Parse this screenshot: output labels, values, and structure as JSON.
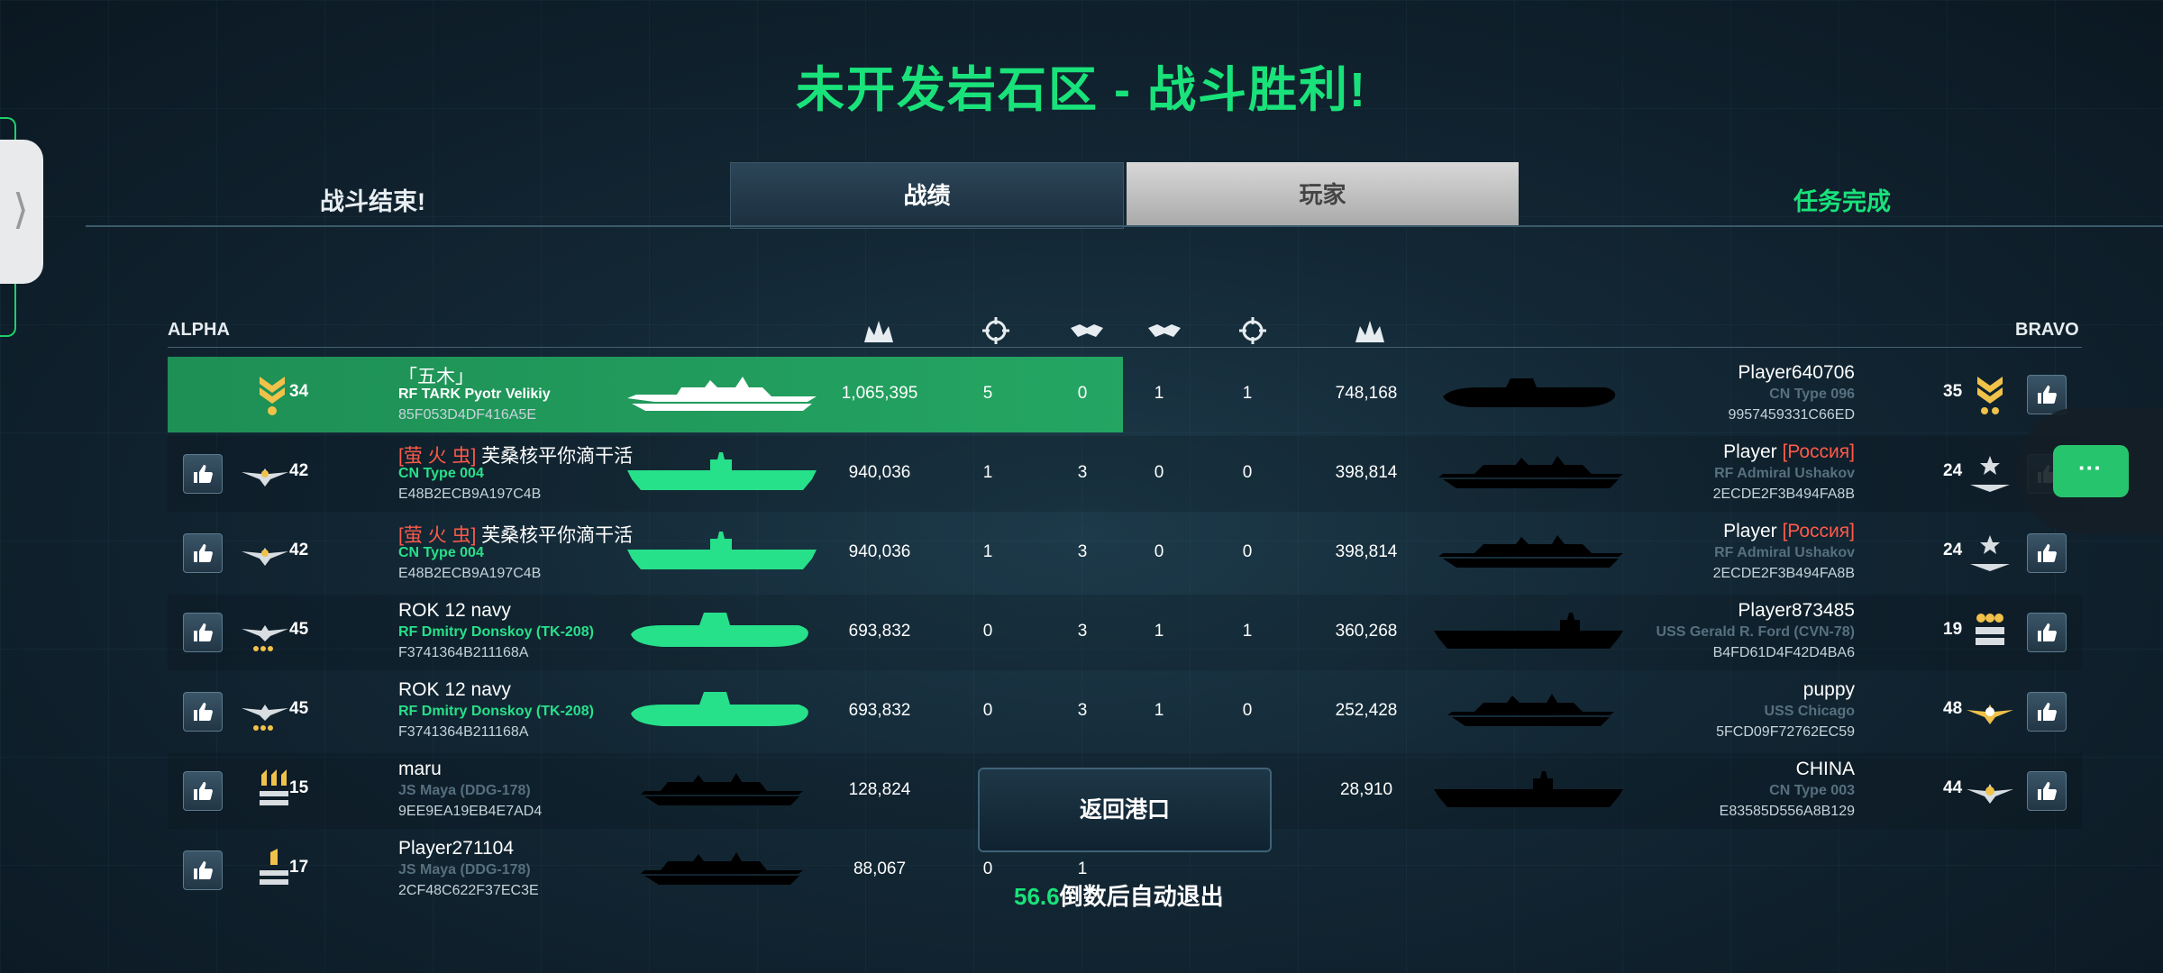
{
  "header": {
    "title": "未开发岩石区 - 战斗胜利!"
  },
  "tabs": {
    "left_label": "战斗结束!",
    "stats_label": "战绩",
    "players_label": "玩家",
    "right_label": "任务完成"
  },
  "teams": {
    "alpha": "ALPHA",
    "bravo": "BRAVO"
  },
  "column_icons": [
    "damage-icon",
    "crosshair-icon",
    "handshake-icon",
    "handshake-icon",
    "crosshair-icon",
    "damage-icon"
  ],
  "rows": [
    {
      "l_clan": "",
      "l_name": "「五木」",
      "l_ship": "RF TARK Pyotr Velikiy",
      "l_id": "85F053D4DF416A5E",
      "l_level": "34",
      "l_damage": "1,065,395",
      "l_kills": "5",
      "l_assists": "0",
      "r_assists": "1",
      "r_kills": "1",
      "r_damage": "748,168",
      "r_name": "Player640706",
      "r_clan": "",
      "r_ship": "CN Type 096",
      "r_id": "9957459331C66ED",
      "r_level": "35"
    },
    {
      "l_clan": "[萤 火 虫]",
      "l_name": " 芙桑核平你滴干活",
      "l_ship": "CN Type 004",
      "l_id": "E48B2ECB9A197C4B",
      "l_level": "42",
      "l_damage": "940,036",
      "l_kills": "1",
      "l_assists": "3",
      "r_assists": "0",
      "r_kills": "0",
      "r_damage": "398,814",
      "r_name": "Player ",
      "r_clan": "[Россия]",
      "r_ship": "RF Admiral Ushakov",
      "r_id": "2ECDE2F3B494FA8B",
      "r_level": "24"
    },
    {
      "l_clan": "[萤 火 虫]",
      "l_name": " 芙桑核平你滴干活",
      "l_ship": "CN Type 004",
      "l_id": "E48B2ECB9A197C4B",
      "l_level": "42",
      "l_damage": "940,036",
      "l_kills": "1",
      "l_assists": "3",
      "r_assists": "0",
      "r_kills": "0",
      "r_damage": "398,814",
      "r_name": "Player ",
      "r_clan": "[Россия]",
      "r_ship": "RF Admiral Ushakov",
      "r_id": "2ECDE2F3B494FA8B",
      "r_level": "24"
    },
    {
      "l_clan": "",
      "l_name": "ROK 12 navy",
      "l_ship": "RF Dmitry Donskoy (TK-208)",
      "l_id": "F3741364B211168A",
      "l_level": "45",
      "l_damage": "693,832",
      "l_kills": "0",
      "l_assists": "3",
      "r_assists": "1",
      "r_kills": "1",
      "r_damage": "360,268",
      "r_name": "Player873485",
      "r_clan": "",
      "r_ship": "USS Gerald R. Ford (CVN-78)",
      "r_id": "B4FD61D4F42D4BA6",
      "r_level": "19"
    },
    {
      "l_clan": "",
      "l_name": "ROK 12 navy",
      "l_ship": "RF Dmitry Donskoy (TK-208)",
      "l_id": "F3741364B211168A",
      "l_level": "45",
      "l_damage": "693,832",
      "l_kills": "0",
      "l_assists": "3",
      "r_assists": "1",
      "r_kills": "0",
      "r_damage": "252,428",
      "r_name": "puppy",
      "r_clan": "",
      "r_ship": "USS Chicago",
      "r_id": "5FCD09F72762EC59",
      "r_level": "48"
    },
    {
      "l_clan": "",
      "l_name": "maru",
      "l_ship": "JS Maya (DDG-178)",
      "l_id": "9EE9EA19EB4E7AD4",
      "l_level": "15",
      "l_damage": "128,824",
      "l_kills": "",
      "l_assists": "",
      "r_assists": "",
      "r_kills": "",
      "r_damage": "28,910",
      "r_name": "CHINA",
      "r_clan": "",
      "r_ship": "CN Type 003",
      "r_id": "E83585D556A8B129",
      "r_level": "44"
    },
    {
      "l_clan": "",
      "l_name": "Player271104",
      "l_ship": "JS Maya (DDG-178)",
      "l_id": "2CF48C622F37EC3E",
      "l_level": "17",
      "l_damage": "88,067",
      "l_kills": "0",
      "l_assists": "1",
      "r_assists": "",
      "r_kills": "",
      "r_damage": "",
      "r_name": "",
      "r_clan": "",
      "r_ship": "",
      "r_id": "",
      "r_level": ""
    }
  ],
  "return_button": "返回港口",
  "countdown": {
    "value": "56.6",
    "text": "倒数后自动退出"
  },
  "float_button": "···",
  "colors": {
    "accent": "#19e27a",
    "highlight": "#24a562",
    "clan": "#ff5a4a"
  }
}
